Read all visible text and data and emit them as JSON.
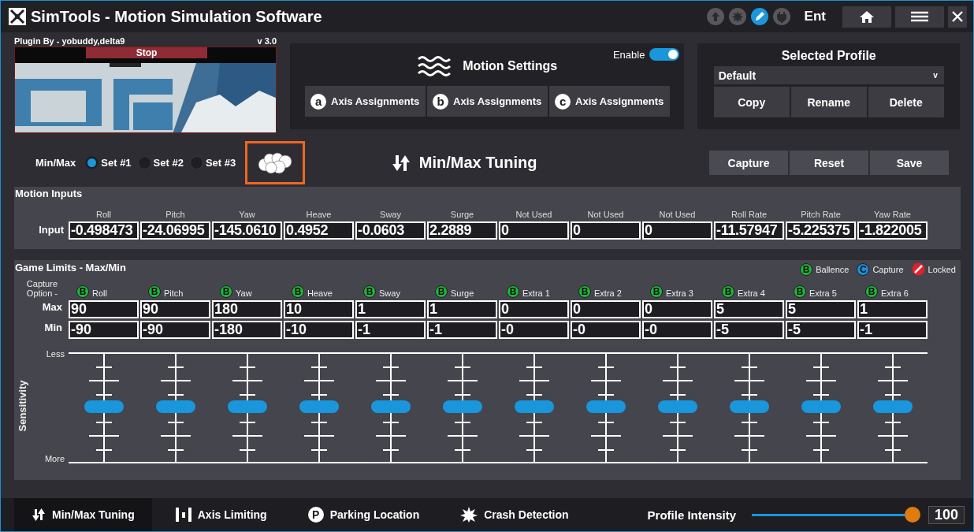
{
  "window": {
    "title": "SimTools - Motion Simulation Software"
  },
  "title_bar": {
    "status_icons": [
      {
        "kind": "upload",
        "selected": false
      },
      {
        "kind": "splat",
        "selected": false
      },
      {
        "kind": "edit",
        "selected": true
      },
      {
        "kind": "plug",
        "selected": false
      }
    ],
    "user": "Ent",
    "buttons": [
      {
        "kind": "home"
      },
      {
        "kind": "menu"
      },
      {
        "kind": "close"
      }
    ]
  },
  "plugin": {
    "author": "Plugin By - yobuddy,delta9",
    "version": "v 3.0",
    "stop_label": "Stop"
  },
  "motion_settings": {
    "title": "Motion Settings",
    "enable_label": "Enable",
    "enabled": true,
    "axis_buttons": [
      {
        "badge": "a",
        "label": "Axis Assignments"
      },
      {
        "badge": "b",
        "label": "Axis Assignments"
      },
      {
        "badge": "c",
        "label": "Axis Assignments"
      }
    ]
  },
  "profile": {
    "title": "Selected Profile",
    "value": "Default",
    "caret": "v",
    "buttons": [
      "Copy",
      "Rename",
      "Delete"
    ]
  },
  "minmax": {
    "label": "Min/Max",
    "sets": [
      {
        "label": "Set #1",
        "selected": true
      },
      {
        "label": "Set #2",
        "selected": false
      },
      {
        "label": "Set #3",
        "selected": false
      }
    ],
    "cloud_button": {
      "highlighted": true
    }
  },
  "tuning_title": "Min/Max Tuning",
  "actions": [
    "Capture",
    "Reset",
    "Save"
  ],
  "motion_inputs": {
    "title": "Motion Inputs",
    "row_label": "Input",
    "columns": [
      {
        "name": "Roll",
        "value": "-0.498473"
      },
      {
        "name": "Pitch",
        "value": "-24.06995"
      },
      {
        "name": "Yaw",
        "value": "-145.0610"
      },
      {
        "name": "Heave",
        "value": "0.4952"
      },
      {
        "name": "Sway",
        "value": "-0.0603"
      },
      {
        "name": "Surge",
        "value": "2.2889"
      },
      {
        "name": "Not Used",
        "value": "0"
      },
      {
        "name": "Not Used",
        "value": "0"
      },
      {
        "name": "Not Used",
        "value": "0"
      },
      {
        "name": "Roll Rate",
        "value": "-11.57947"
      },
      {
        "name": "Pitch Rate",
        "value": "-5.225375"
      },
      {
        "name": "Yaw Rate",
        "value": "-1.822005"
      }
    ]
  },
  "game_limits": {
    "title": "Game Limits - Max/Min",
    "legend": [
      {
        "kind": "balance",
        "badge": "B",
        "label": "Ballence",
        "color": "#1fb53a"
      },
      {
        "kind": "capture",
        "badge": "C",
        "label": "Capture",
        "color": "#1a8fd6"
      },
      {
        "kind": "locked",
        "label": "Locked",
        "color": "#e0202a"
      }
    ],
    "capture_label": "Capture Option -",
    "max_label": "Max",
    "min_label": "Min",
    "sensitivity": {
      "label": "Sensitivity",
      "less": "Less",
      "more": "More"
    },
    "columns": [
      {
        "name": "Roll",
        "kind": "balance",
        "badge": "B",
        "max": "90",
        "min": "-90",
        "level": 0.5
      },
      {
        "name": "Pitch",
        "kind": "balance",
        "badge": "B",
        "max": "90",
        "min": "-90",
        "level": 0.5
      },
      {
        "name": "Yaw",
        "kind": "balance",
        "badge": "B",
        "max": "180",
        "min": "-180",
        "level": 0.5
      },
      {
        "name": "Heave",
        "kind": "balance",
        "badge": "B",
        "max": "10",
        "min": "-10",
        "level": 0.5
      },
      {
        "name": "Sway",
        "kind": "balance",
        "badge": "B",
        "max": "1",
        "min": "-1",
        "level": 0.5
      },
      {
        "name": "Surge",
        "kind": "balance",
        "badge": "B",
        "max": "1",
        "min": "-1",
        "level": 0.5
      },
      {
        "name": "Extra 1",
        "kind": "balance",
        "badge": "B",
        "max": "0",
        "min": "-0",
        "level": 0.5
      },
      {
        "name": "Extra 2",
        "kind": "balance",
        "badge": "B",
        "max": "0",
        "min": "-0",
        "level": 0.5
      },
      {
        "name": "Extra 3",
        "kind": "balance",
        "badge": "B",
        "max": "0",
        "min": "-0",
        "level": 0.5
      },
      {
        "name": "Extra 4",
        "kind": "balance",
        "badge": "B",
        "max": "5",
        "min": "-5",
        "level": 0.5
      },
      {
        "name": "Extra 5",
        "kind": "balance",
        "badge": "B",
        "max": "5",
        "min": "-5",
        "level": 0.5
      },
      {
        "name": "Extra 6",
        "kind": "balance",
        "badge": "B",
        "max": "1",
        "min": "-1",
        "level": 0.5
      }
    ]
  },
  "bottom_bar": {
    "tabs": [
      {
        "kind": "minmax",
        "label": "Min/Max Tuning",
        "selected": true
      },
      {
        "kind": "limits",
        "label": "Axis Limiting",
        "selected": false
      },
      {
        "kind": "parking",
        "badge": "P",
        "label": "Parking Location",
        "selected": false
      },
      {
        "kind": "crash",
        "label": "Crash Detection",
        "selected": false
      }
    ],
    "intensity": {
      "label": "Profile Intensity",
      "level": 0.96,
      "value": "100"
    }
  }
}
